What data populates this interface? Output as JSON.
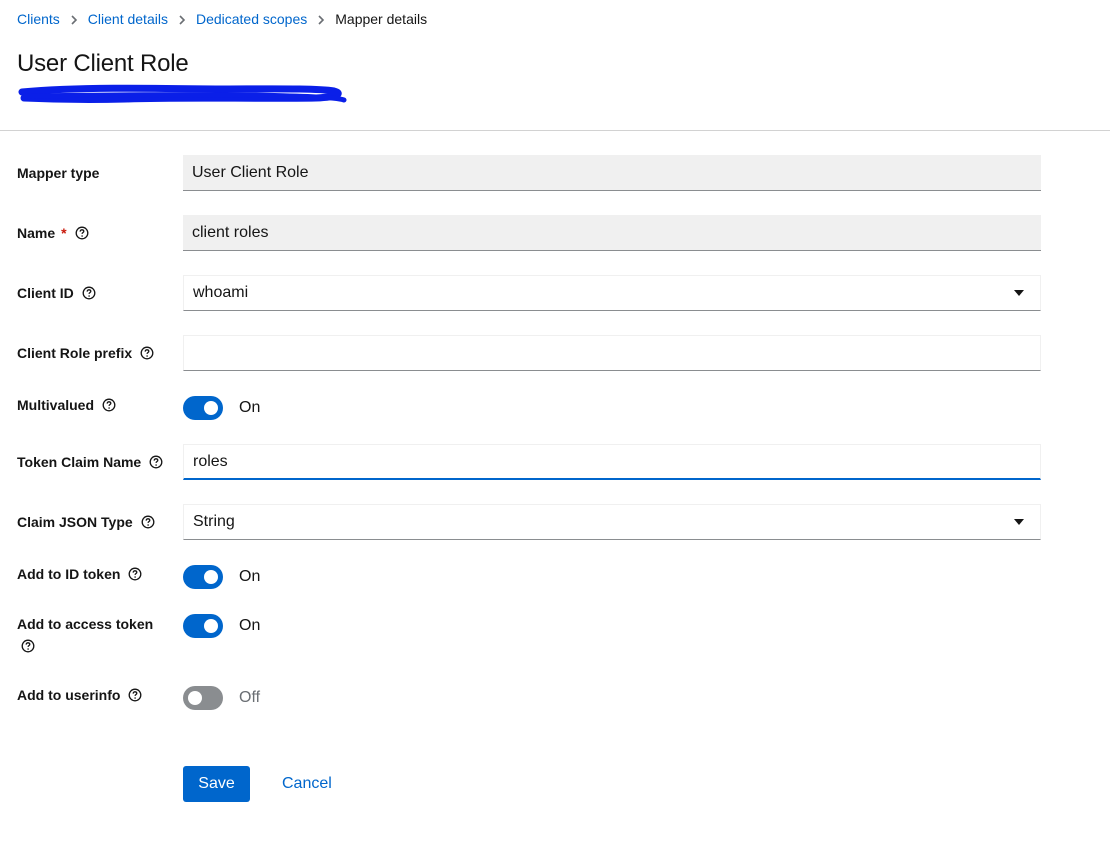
{
  "breadcrumb": [
    {
      "label": "Clients"
    },
    {
      "label": "Client details"
    },
    {
      "label": "Dedicated scopes"
    }
  ],
  "breadcrumb_current": "Mapper details",
  "page_title": "User Client Role",
  "form": {
    "mapper_type": {
      "label": "Mapper type",
      "value": "User Client Role"
    },
    "name": {
      "label": "Name",
      "required_mark": "*",
      "value": "client roles"
    },
    "client_id": {
      "label": "Client ID",
      "value": "whoami"
    },
    "client_role_prefix": {
      "label": "Client Role prefix",
      "value": ""
    },
    "multivalued": {
      "label": "Multivalued",
      "state": "On"
    },
    "token_claim_name": {
      "label": "Token Claim Name",
      "value": "roles"
    },
    "claim_json_type": {
      "label": "Claim JSON Type",
      "value": "String"
    },
    "add_to_id_token": {
      "label": "Add to ID token",
      "state": "On"
    },
    "add_to_access_token": {
      "label": "Add to access token",
      "state": "On"
    },
    "add_to_userinfo": {
      "label": "Add to userinfo",
      "state": "Off"
    }
  },
  "actions": {
    "save_label": "Save",
    "cancel_label": "Cancel"
  },
  "colors": {
    "primary": "#0066cc",
    "required": "#c9190b",
    "toggle_off": "#8a8d90",
    "redaction": "#0a1fe8"
  }
}
